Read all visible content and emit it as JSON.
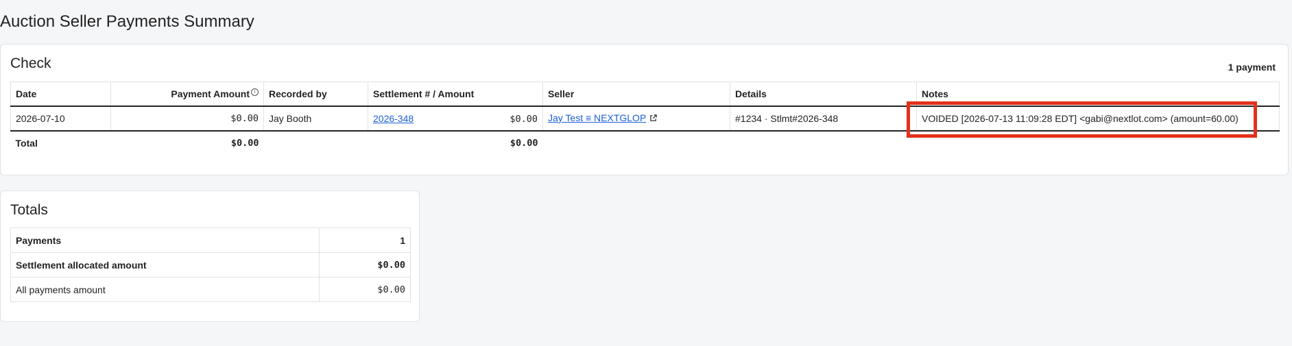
{
  "page_title": "Auction Seller Payments Summary",
  "check_section": {
    "title": "Check",
    "payment_count": "1 payment",
    "columns": {
      "date": "Date",
      "payment_amount": "Payment Amount",
      "recorded_by": "Recorded by",
      "settlement": "Settlement # / Amount",
      "seller": "Seller",
      "details": "Details",
      "notes": "Notes"
    },
    "row": {
      "date": "2026-07-10",
      "payment_amount": "$0.00",
      "recorded_by": "Jay Booth",
      "settlement_number": "2026-348",
      "settlement_amount": "$0.00",
      "seller": "Jay Test ≡ NEXTGLOP",
      "details": "#1234 · Stlmt#2026-348",
      "notes": "VOIDED [2026-07-13 11:09:28 EDT] <gabi@nextlot.com> (amount=60.00)"
    },
    "total": {
      "label": "Total",
      "payment_amount": "$0.00",
      "settlement_amount": "$0.00"
    }
  },
  "totals_section": {
    "title": "Totals",
    "rows": [
      {
        "label": "Payments",
        "value": "1"
      },
      {
        "label": "Settlement allocated amount",
        "value": "$0.00"
      },
      {
        "label": "All payments amount",
        "value": "$0.00"
      }
    ]
  },
  "colors": {
    "highlight": "#e3301a",
    "link": "#1a5fd6"
  },
  "icons": {
    "info": "info-circle-icon",
    "external_link": "external-link-icon"
  }
}
